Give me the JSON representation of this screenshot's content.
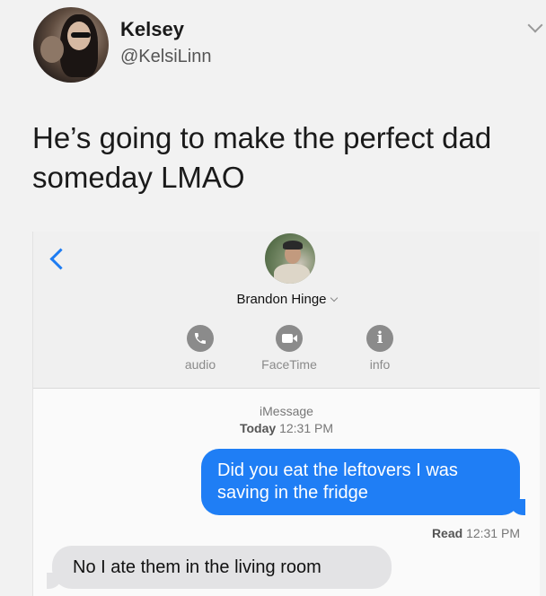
{
  "tweet": {
    "author_name": "Kelsey",
    "author_handle": "@KelsiLinn",
    "text": "He’s going to make the perfect dad someday LMAO"
  },
  "imessage": {
    "contact_name": "Brandon Hinge",
    "actions": [
      {
        "label": "audio",
        "icon": "phone-icon"
      },
      {
        "label": "FaceTime",
        "icon": "video-camera-icon"
      },
      {
        "label": "info",
        "icon": "info-icon"
      }
    ],
    "service_label": "iMessage",
    "timestamp_day": "Today",
    "timestamp_time": "12:31 PM",
    "messages": [
      {
        "direction": "outgoing",
        "text": "Did you eat the leftovers I was saving in the fridge"
      },
      {
        "direction": "incoming",
        "text": "No I ate them in the living room"
      }
    ],
    "read_label": "Read",
    "read_time": "12:31 PM"
  },
  "colors": {
    "outgoing_bubble": "#1f7ef5",
    "incoming_bubble": "#e3e3e5",
    "back_arrow": "#1d7cf2",
    "action_circle": "#8b8b8b"
  }
}
